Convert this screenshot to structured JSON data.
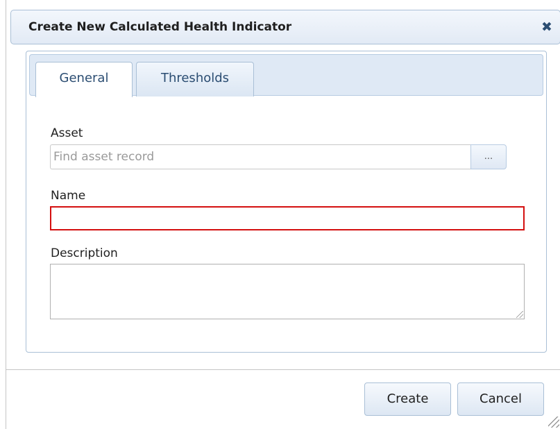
{
  "dialog": {
    "title": "Create New Calculated Health Indicator",
    "close_icon": "close-icon",
    "close_glyph": "✖"
  },
  "tabs": [
    {
      "label": "General",
      "selected": true
    },
    {
      "label": "Thresholds",
      "selected": false
    }
  ],
  "form": {
    "asset": {
      "label": "Asset",
      "value": "",
      "placeholder": "Find asset record",
      "lookup_label": "..."
    },
    "name": {
      "label": "Name",
      "value": "",
      "validation_color": "#d40f0f"
    },
    "description": {
      "label": "Description",
      "value": ""
    }
  },
  "buttons": {
    "create_label": "Create",
    "cancel_label": "Cancel"
  },
  "colors": {
    "header_border": "#a9bfd6",
    "accent_text": "#2b4d72"
  }
}
